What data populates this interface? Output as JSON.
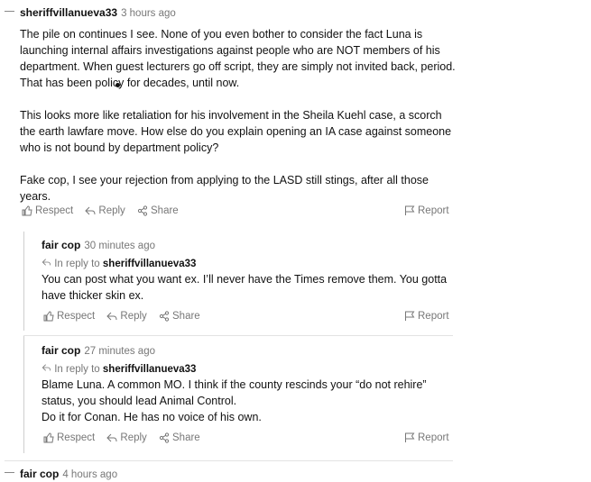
{
  "actions": {
    "respect": "Respect",
    "reply": "Reply",
    "share": "Share",
    "report": "Report",
    "in_reply_to": "In reply to"
  },
  "comments": [
    {
      "author": "sheriffvillanueva33",
      "time": "3 hours ago",
      "paragraphs": [
        "The pile on continues I see. None of you even bother to consider the fact Luna is launching internal affairs investigations against people who are NOT members of his department. When guest lecturers go off script, they are simply not invited back, period. That has been policy for decades, until now.",
        "This looks more like retaliation for his involvement in the Sheila Kuehl case, a scorch the earth lawfare move. How else do you explain opening an IA case against someone who is not bound by department policy?",
        "Fake cop, I see your rejection from applying to the LASD still stings, after all those years."
      ]
    },
    {
      "author": "fair cop",
      "time": "30 minutes ago",
      "reply_to": "sheriffvillanueva33",
      "paragraphs": [
        "You can post what you want ex. I’ll never have the Times remove them. You gotta have thicker skin ex."
      ]
    },
    {
      "author": "fair cop",
      "time": "27 minutes ago",
      "reply_to": "sheriffvillanueva33",
      "paragraphs": [
        "Blame Luna. A common MO. I think if the county rescinds your “do not rehire” status, you should lead Animal Control.",
        "Do it for Conan. He has no voice of his own."
      ]
    },
    {
      "author": "fair cop",
      "time": "4 hours ago"
    }
  ]
}
